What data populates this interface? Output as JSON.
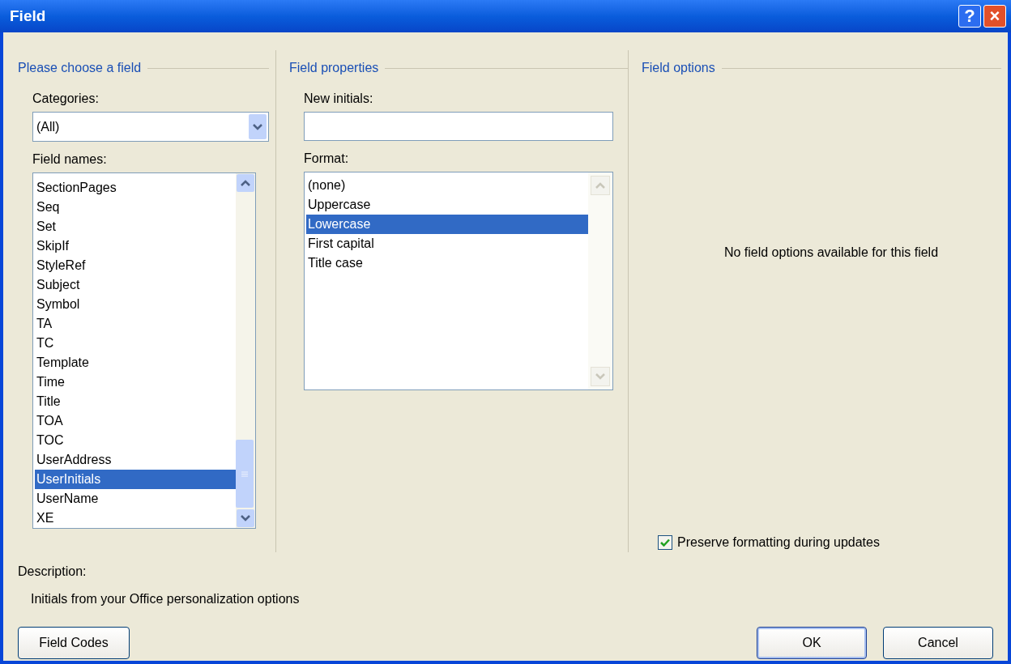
{
  "window": {
    "title": "Field",
    "controls": [
      {
        "kind": "help",
        "label": "?"
      },
      {
        "kind": "close",
        "label": "×"
      }
    ]
  },
  "choose": {
    "heading": "Please choose a field",
    "categories_label": "Categories:",
    "categories_value": "(All)",
    "names_label": "Field names:",
    "field_names": [
      {
        "label": "SectionPages",
        "selected": false
      },
      {
        "label": "Seq",
        "selected": false
      },
      {
        "label": "Set",
        "selected": false
      },
      {
        "label": "SkipIf",
        "selected": false
      },
      {
        "label": "StyleRef",
        "selected": false
      },
      {
        "label": "Subject",
        "selected": false
      },
      {
        "label": "Symbol",
        "selected": false
      },
      {
        "label": "TA",
        "selected": false
      },
      {
        "label": "TC",
        "selected": false
      },
      {
        "label": "Template",
        "selected": false
      },
      {
        "label": "Time",
        "selected": false
      },
      {
        "label": "Title",
        "selected": false
      },
      {
        "label": "TOA",
        "selected": false
      },
      {
        "label": "TOC",
        "selected": false
      },
      {
        "label": "UserAddress",
        "selected": false
      },
      {
        "label": "UserInitials",
        "selected": true
      },
      {
        "label": "UserName",
        "selected": false
      },
      {
        "label": "XE",
        "selected": false
      }
    ]
  },
  "properties": {
    "heading": "Field properties",
    "initials_label": "New initials:",
    "format_label": "Format:",
    "formats": [
      {
        "label": "(none)",
        "selected": false
      },
      {
        "label": "Uppercase",
        "selected": false
      },
      {
        "label": "Lowercase",
        "selected": true
      },
      {
        "label": "First capital",
        "selected": false
      },
      {
        "label": "Title case",
        "selected": false
      }
    ]
  },
  "options": {
    "heading": "Field options",
    "message": "No field options available for this field",
    "preserve": {
      "label": "Preserve formatting during updates",
      "checked": true
    }
  },
  "description": {
    "label": "Description:",
    "text": "Initials from your Office personalization options"
  },
  "buttons": [
    {
      "label": "Field Codes",
      "default": false
    },
    {
      "label": "OK",
      "default": true
    },
    {
      "label": "Cancel",
      "default": false
    }
  ]
}
